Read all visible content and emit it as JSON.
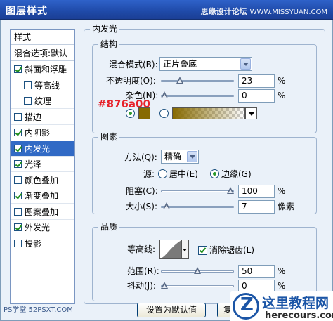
{
  "window": {
    "title": "图层样式",
    "watermark_cn": "思缘设计论坛",
    "watermark_url": "WWW.MISSYUAN.COM"
  },
  "stylelist": {
    "header": "样式",
    "blend_options": "混合选项:默认",
    "items": [
      {
        "label": "斜面和浮雕",
        "checked": true,
        "indent": false
      },
      {
        "label": "等高线",
        "checked": false,
        "indent": true
      },
      {
        "label": "纹理",
        "checked": false,
        "indent": true
      },
      {
        "label": "描边",
        "checked": false,
        "indent": false
      },
      {
        "label": "内阴影",
        "checked": true,
        "indent": false
      },
      {
        "label": "内发光",
        "checked": true,
        "indent": false,
        "selected": true
      },
      {
        "label": "光泽",
        "checked": true,
        "indent": false
      },
      {
        "label": "颜色叠加",
        "checked": false,
        "indent": false
      },
      {
        "label": "渐变叠加",
        "checked": true,
        "indent": false
      },
      {
        "label": "图案叠加",
        "checked": false,
        "indent": false
      },
      {
        "label": "外发光",
        "checked": true,
        "indent": false
      },
      {
        "label": "投影",
        "checked": false,
        "indent": false
      }
    ]
  },
  "panel": {
    "title": "内发光",
    "structure": {
      "title": "结构",
      "blend_mode_label": "混合模式(B):",
      "blend_mode_value": "正片叠底",
      "opacity_label": "不透明度(O):",
      "opacity_value": "23",
      "opacity_unit": "%",
      "opacity_fraction": 0.23,
      "noise_label": "杂色(N):",
      "noise_value": "0",
      "noise_unit": "%",
      "noise_fraction": 0.0,
      "color_annotation": "#876a00",
      "glow_color": "#876a00"
    },
    "elements": {
      "title": "图素",
      "method_label": "方法(Q):",
      "method_value": "精确",
      "source_label": "源:",
      "source_center": "居中(E)",
      "source_edge": "边缘(G)",
      "source_selected": "edge",
      "choke_label": "阻塞(C):",
      "choke_value": "100",
      "choke_unit": "%",
      "choke_fraction": 1.0,
      "size_label": "大小(S):",
      "size_value": "7",
      "size_unit": "像素",
      "size_fraction": 0.03
    },
    "quality": {
      "title": "品质",
      "contour_label": "等高线:",
      "antialias_label": "消除锯齿(L)",
      "antialias_checked": true,
      "range_label": "范围(R):",
      "range_value": "50",
      "range_unit": "%",
      "range_fraction": 0.5,
      "jitter_label": "抖动(J):",
      "jitter_value": "0",
      "jitter_unit": "%",
      "jitter_fraction": 0.0
    },
    "buttons": {
      "set_default": "设置为默认值",
      "reset": "复"
    }
  },
  "footer": {
    "watermark": "PS学堂 52PSXT.COM",
    "logo_text": "这里教程网",
    "logo_sub": "herecours.com"
  }
}
